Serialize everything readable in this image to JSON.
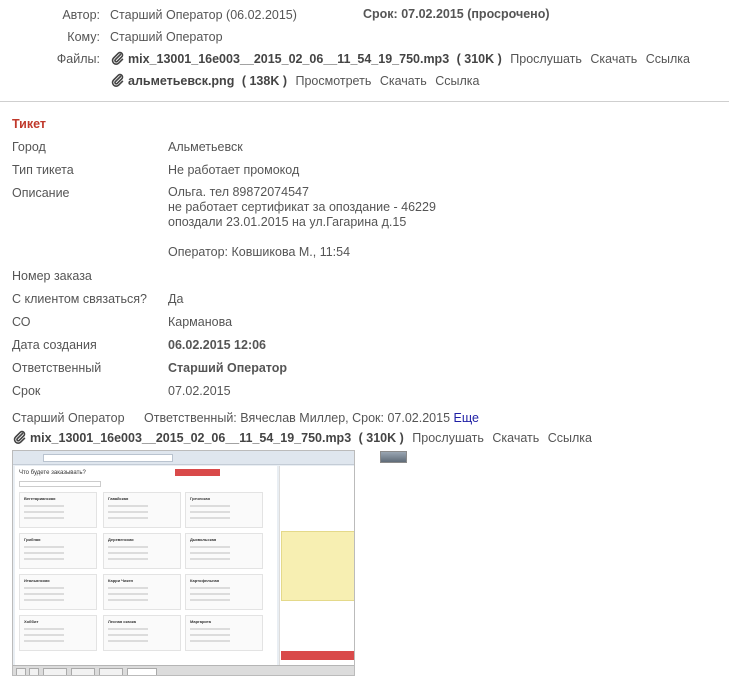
{
  "header": {
    "author_label": "Автор:",
    "author_name": "Старший Оператор",
    "author_date": "(06.02.2015)",
    "deadline": "Срок: 07.02.2015 (просрочено)",
    "to_label": "Кому:",
    "to_value": "Старший Оператор",
    "files_label": "Файлы:",
    "files": [
      {
        "name": "mix_13001_16e003__2015_02_06__11_54_19_750.mp3",
        "size": "( 310K )",
        "actions": [
          "Прослушать",
          "Скачать",
          "Ссылка"
        ]
      },
      {
        "name": "альметьевск.png",
        "size": "( 138K )",
        "actions": [
          "Просмотреть",
          "Скачать",
          "Ссылка"
        ]
      }
    ]
  },
  "ticket": {
    "title": "Тикет",
    "fields": {
      "city": {
        "label": "Город",
        "value": "Альметьевск"
      },
      "type": {
        "label": "Тип тикета",
        "value": "Не работает промокод"
      },
      "description": {
        "label": "Описание",
        "lines": [
          "Ольга. тел 89872074547",
          "не работает сертификат за опоздание - 46229",
          "опоздали 23.01.2015 на ул.Гагарина д.15",
          "Оператор: Ковшикова М., 11:54"
        ]
      },
      "order": {
        "label": "Номер заказа",
        "value": ""
      },
      "contact": {
        "label": "С клиентом связаться?",
        "value": "Да"
      },
      "co": {
        "label": "СО",
        "value": "Карманова"
      },
      "created": {
        "label": "Дата создания",
        "value": "06.02.2015 12:06"
      },
      "responsible": {
        "label": "Ответственный",
        "value": "Старший Оператор"
      },
      "deadline": {
        "label": "Срок",
        "value": "07.02.2015"
      }
    }
  },
  "comment": {
    "author": "Старший Оператор",
    "text": "Ответственный: Вячеслав Миллер, Срок: 07.02.2015",
    "more": "Еще",
    "file": {
      "name": "mix_13001_16e003__2015_02_06__11_54_19_750.mp3",
      "size": "( 310K )",
      "actions": [
        "Прослушать",
        "Скачать",
        "Ссылка"
      ]
    },
    "screenshot": {
      "heading": "Что будете заказывать?",
      "cards": [
        "Вегетарианская",
        "Гавайская",
        "Греческая",
        "Грибная",
        "Деревенская",
        "Дьявольская",
        "Итальянская",
        "Карри Чикен",
        "Картофельная",
        "Хоббит",
        "Лесная сказка",
        "Маргарита"
      ]
    }
  },
  "colors": {
    "accent_red": "#c0392b",
    "link_blue": "#1f1fa5"
  }
}
